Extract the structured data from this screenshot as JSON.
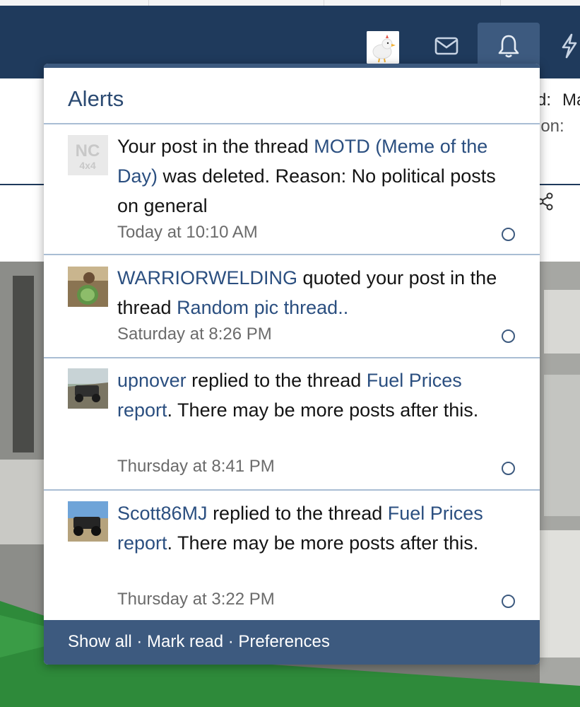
{
  "header": {
    "partial_text_1": "d:",
    "partial_text_2": "Ma",
    "partial_text_3": "ion:"
  },
  "icons": {
    "nav_user_avatar": "chicken-avatar-icon",
    "nav_inbox": "envelope-icon",
    "nav_alerts": "bell-icon",
    "nav_whats_new": "bolt-icon",
    "share": "share-icon",
    "mark_read": "circle-outline-icon"
  },
  "colors": {
    "navbar": "#1f3a5c",
    "accent": "#3d5a7f",
    "link": "#2b4f80",
    "divider": "#a9bdd4"
  },
  "alerts_popup": {
    "title": "Alerts",
    "items": [
      {
        "avatar": "NC 4x4",
        "segments": [
          "Your post in the thread ",
          "MOTD (Meme of the Day)",
          " was deleted. Reason: No political posts on general"
        ],
        "time": "Today at 10:10 AM"
      },
      {
        "avatar": "user-photo",
        "segments": [
          "WARRIORWELDING",
          " quoted your post in the thread ",
          "Random pic thread..",
          ""
        ],
        "time": "Saturday at 8:26 PM"
      },
      {
        "avatar": "user-photo",
        "segments": [
          "upnover",
          " replied to the thread ",
          "Fuel Prices report",
          ". There may be more posts after this."
        ],
        "time": "Thursday at 8:41 PM"
      },
      {
        "avatar": "user-photo",
        "segments": [
          "Scott86MJ",
          " replied to the thread ",
          "Fuel Prices report",
          ". There may be more posts after this."
        ],
        "time": "Thursday at 3:22 PM"
      }
    ],
    "footer": {
      "show_all": "Show all",
      "separator": " · ",
      "mark_read": "Mark read",
      "preferences": "Preferences"
    }
  }
}
